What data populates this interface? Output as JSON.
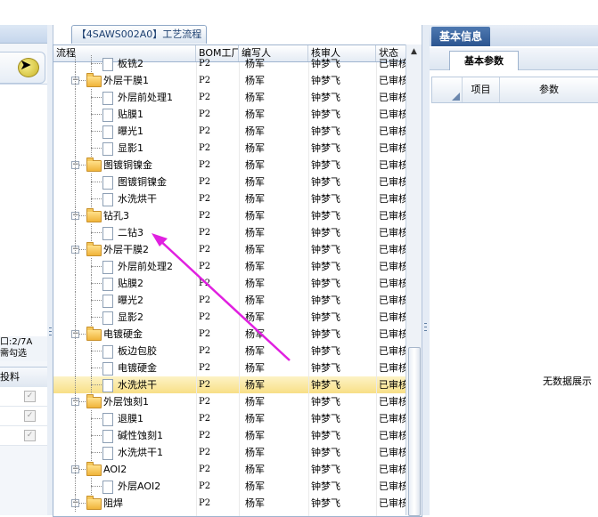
{
  "center_tab": {
    "title": "【4SAWS002A0】工艺流程"
  },
  "grid": {
    "columns": [
      "流程",
      "BOM工厂",
      "编写人",
      "核审人",
      "状态"
    ],
    "rows": [
      {
        "name": "板铣2",
        "type": "doc",
        "level": 2,
        "bom": "P2",
        "writer": "杨军",
        "reviewer": "钟梦飞",
        "status": "已审核"
      },
      {
        "name": "外层干膜1",
        "type": "folder",
        "level": 1,
        "bom": "P2",
        "writer": "杨军",
        "reviewer": "钟梦飞",
        "status": "已审核"
      },
      {
        "name": "外层前处理1",
        "type": "doc",
        "level": 2,
        "bom": "P2",
        "writer": "杨军",
        "reviewer": "钟梦飞",
        "status": "已审核"
      },
      {
        "name": "贴膜1",
        "type": "doc",
        "level": 2,
        "bom": "P2",
        "writer": "杨军",
        "reviewer": "钟梦飞",
        "status": "已审核"
      },
      {
        "name": "曝光1",
        "type": "doc",
        "level": 2,
        "bom": "P2",
        "writer": "杨军",
        "reviewer": "钟梦飞",
        "status": "已审核"
      },
      {
        "name": "显影1",
        "type": "doc",
        "level": 2,
        "bom": "P2",
        "writer": "杨军",
        "reviewer": "钟梦飞",
        "status": "已审核"
      },
      {
        "name": "图镀铜镍金",
        "type": "folder",
        "level": 1,
        "bom": "P2",
        "writer": "杨军",
        "reviewer": "钟梦飞",
        "status": "已审核"
      },
      {
        "name": "图镀铜镍金",
        "type": "doc",
        "level": 2,
        "bom": "P2",
        "writer": "杨军",
        "reviewer": "钟梦飞",
        "status": "已审核"
      },
      {
        "name": "水洗烘干",
        "type": "doc",
        "level": 2,
        "bom": "P2",
        "writer": "杨军",
        "reviewer": "钟梦飞",
        "status": "已审核"
      },
      {
        "name": "钻孔3",
        "type": "folder",
        "level": 1,
        "bom": "P2",
        "writer": "杨军",
        "reviewer": "钟梦飞",
        "status": "已审核"
      },
      {
        "name": "二钻3",
        "type": "doc",
        "level": 2,
        "bom": "P2",
        "writer": "杨军",
        "reviewer": "钟梦飞",
        "status": "已审核"
      },
      {
        "name": "外层干膜2",
        "type": "folder",
        "level": 1,
        "bom": "P2",
        "writer": "杨军",
        "reviewer": "钟梦飞",
        "status": "已审核"
      },
      {
        "name": "外层前处理2",
        "type": "doc",
        "level": 2,
        "bom": "P2",
        "writer": "杨军",
        "reviewer": "钟梦飞",
        "status": "已审核"
      },
      {
        "name": "贴膜2",
        "type": "doc",
        "level": 2,
        "bom": "P2",
        "writer": "杨军",
        "reviewer": "钟梦飞",
        "status": "已审核"
      },
      {
        "name": "曝光2",
        "type": "doc",
        "level": 2,
        "bom": "P2",
        "writer": "杨军",
        "reviewer": "钟梦飞",
        "status": "已审核"
      },
      {
        "name": "显影2",
        "type": "doc",
        "level": 2,
        "bom": "P2",
        "writer": "杨军",
        "reviewer": "钟梦飞",
        "status": "已审核"
      },
      {
        "name": "电镀硬金",
        "type": "folder",
        "level": 1,
        "bom": "P2",
        "writer": "杨军",
        "reviewer": "钟梦飞",
        "status": "已审核"
      },
      {
        "name": "板边包胶",
        "type": "doc",
        "level": 2,
        "bom": "P2",
        "writer": "杨军",
        "reviewer": "钟梦飞",
        "status": "已审核"
      },
      {
        "name": "电镀硬金",
        "type": "doc",
        "level": 2,
        "bom": "P2",
        "writer": "杨军",
        "reviewer": "钟梦飞",
        "status": "已审核"
      },
      {
        "name": "水洗烘干",
        "type": "doc",
        "level": 2,
        "bom": "P2",
        "writer": "杨军",
        "reviewer": "钟梦飞",
        "status": "已审核",
        "selected": true
      },
      {
        "name": "外层蚀刻1",
        "type": "folder",
        "level": 1,
        "bom": "P2",
        "writer": "杨军",
        "reviewer": "钟梦飞",
        "status": "已审核"
      },
      {
        "name": "退膜1",
        "type": "doc",
        "level": 2,
        "bom": "P2",
        "writer": "杨军",
        "reviewer": "钟梦飞",
        "status": "已审核"
      },
      {
        "name": "碱性蚀刻1",
        "type": "doc",
        "level": 2,
        "bom": "P2",
        "writer": "杨军",
        "reviewer": "钟梦飞",
        "status": "已审核"
      },
      {
        "name": "水洗烘干1",
        "type": "doc",
        "level": 2,
        "bom": "P2",
        "writer": "杨军",
        "reviewer": "钟梦飞",
        "status": "已审核"
      },
      {
        "name": "AOI2",
        "type": "folder",
        "level": 1,
        "bom": "P2",
        "writer": "杨军",
        "reviewer": "钟梦飞",
        "status": "已审核"
      },
      {
        "name": "外层AOI2",
        "type": "doc",
        "level": 2,
        "bom": "P2",
        "writer": "杨军",
        "reviewer": "钟梦飞",
        "status": "已审核"
      },
      {
        "name": "阻焊",
        "type": "folder",
        "level": 1,
        "bom": "P2",
        "writer": "杨军",
        "reviewer": "钟梦飞",
        "status": "已审核"
      }
    ]
  },
  "left": {
    "status_line1": "口:2/7A",
    "status_line2": "需勾选",
    "grid_header": "投料",
    "check_rows": 3
  },
  "right": {
    "tab_basic_info": "基本信息",
    "tab_basic_params": "基本参数",
    "col_item": "项目",
    "col_param": "参数",
    "empty_text": "无数据展示"
  },
  "colors": {
    "selected_row": "#f8df86",
    "tab_active": "#2b5590",
    "annotation_arrow": "#e020e0"
  }
}
